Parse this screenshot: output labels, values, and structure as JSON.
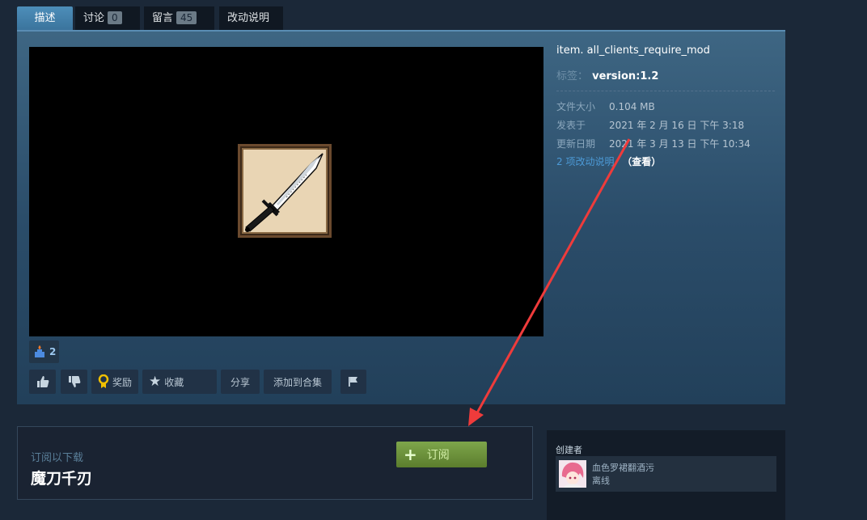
{
  "tabs": [
    {
      "label": "描述"
    },
    {
      "label": "讨论",
      "count": "0"
    },
    {
      "label": "留言",
      "count": "45"
    },
    {
      "label": "改动说明"
    }
  ],
  "award": {
    "count": "2"
  },
  "actions": {
    "award_label": "奖励",
    "favorite_label": "收藏",
    "share_label": "分享",
    "add_collection_label": "添加到合集"
  },
  "details": {
    "tag_title": "item. all_clients_require_mod",
    "tags_label": "标签：",
    "tags_value": "version:1.2",
    "file_size_label": "文件大小",
    "file_size": "0.104 MB",
    "posted_label": "发表于",
    "posted": "2021 年 2 月 16 日 下午 3:18",
    "updated_label": "更新日期",
    "updated": "2021 年 3 月 13 日 下午 10:34",
    "changes_link": "2 项改动说明",
    "view_label": "（查看）"
  },
  "subscribe": {
    "caption": "订阅以下载",
    "title": "魔刀千刃",
    "button_label": "订阅"
  },
  "creator": {
    "heading": "创建者",
    "name": "血色罗裙翻酒污",
    "status": "离线"
  },
  "colors": {
    "accent": "#4d8eb9",
    "subscribe_green": "#7ea64b",
    "annotation_arrow": "#ef3b3b"
  }
}
